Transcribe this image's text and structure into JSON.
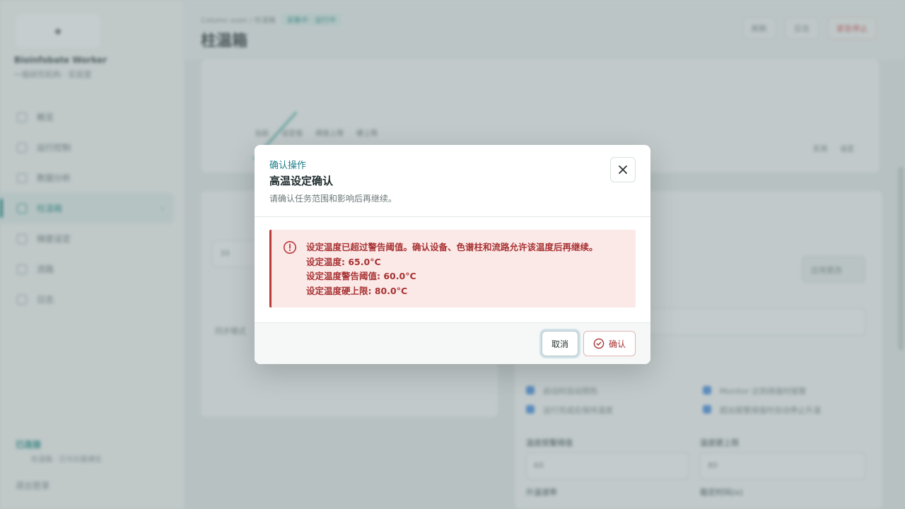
{
  "background": {
    "sidebar": {
      "instrument_name": "Bioinfobate Worker",
      "instrument_sub": "一般研究机构 · 实验室",
      "nav_items": [
        {
          "label": "概览"
        },
        {
          "label": "运行控制"
        },
        {
          "label": "数据分析"
        },
        {
          "label": "柱温箱"
        },
        {
          "label": "梯度设定"
        },
        {
          "label": "流路"
        },
        {
          "label": "日志"
        }
      ],
      "connection_title": "已连接",
      "connection_sub": "柱温箱 · 已与仪器通信",
      "logout_label": "退出登录"
    },
    "topbar": {
      "crumb_root": "Column oven / 柱温箱",
      "crumb_chip": "采集中 · 运行中",
      "page_title": "柱温箱",
      "actions": [
        "刷新",
        "日志",
        "紧急停止"
      ]
    },
    "chart": {
      "legend_row": [
        "当前",
        "设定值",
        "阈值上限",
        "硬上限"
      ],
      "keys": [
        "实测",
        "设定"
      ]
    },
    "left_panel": {
      "field_value": "30",
      "check_label": "同步模式"
    },
    "right_panel": {
      "button_label": "应用更改",
      "options": [
        "启动时自动预热",
        "Monitor 达到阈值时报警",
        "运行完成后保持温度",
        "超出报警阈值时自动停止升温"
      ],
      "field_labels": [
        "温度报警阈值",
        "温度硬上限",
        "升温速率",
        "稳定时间(s)"
      ],
      "field_values": [
        "60",
        "80"
      ]
    }
  },
  "dialog": {
    "eyebrow": "确认操作",
    "title": "高温设定确认",
    "description": "请确认任务范围和影响后再继续。",
    "alert_lines": [
      "设定温度已超过警告阈值。确认设备、色谱柱和流路允许该温度后再继续。",
      "设定温度: 65.0°C",
      "设定温度警告阈值: 60.0°C",
      "设定温度硬上限: 80.0°C"
    ],
    "cancel_label": "取消",
    "confirm_label": "确认"
  },
  "colors": {
    "accent": "#1b8a86",
    "danger": "#a83232",
    "alert_bg": "#fbe9e8"
  }
}
